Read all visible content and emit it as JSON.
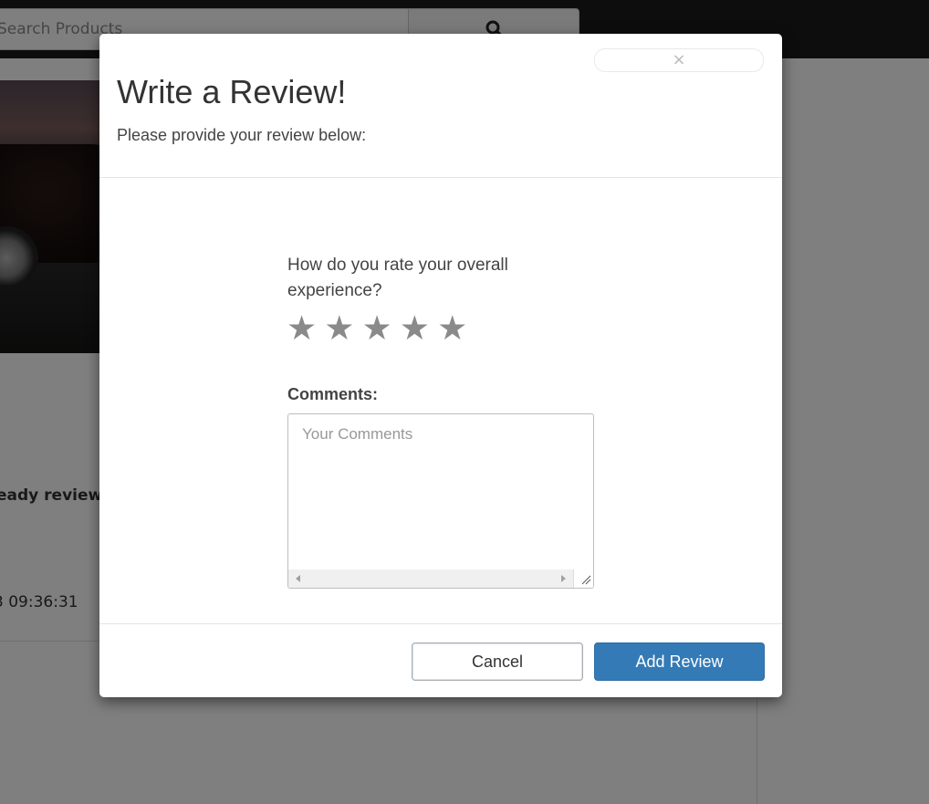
{
  "background": {
    "search": {
      "placeholder": "Search Products"
    },
    "review_text": "eady reviewe",
    "review_time": "3 09:36:31"
  },
  "modal": {
    "close_symbol": "×",
    "title": "Write a Review!",
    "subtitle": "Please provide your review below:",
    "rating": {
      "question": "How do you rate your overall experience?",
      "stars": [
        "★",
        "★",
        "★",
        "★",
        "★"
      ],
      "max": 5,
      "selected": 0
    },
    "comments": {
      "label": "Comments:",
      "placeholder": "Your Comments",
      "value": ""
    },
    "buttons": {
      "cancel": "Cancel",
      "add": "Add Review"
    }
  },
  "colors": {
    "primary": "#337ab7",
    "overlay": "rgba(0,0,0,0.5)",
    "topbar": "#1b1b1b",
    "star": "#8a8a8a"
  },
  "icons": {
    "search": "search-icon",
    "close": "close-icon",
    "star": "star-icon"
  }
}
